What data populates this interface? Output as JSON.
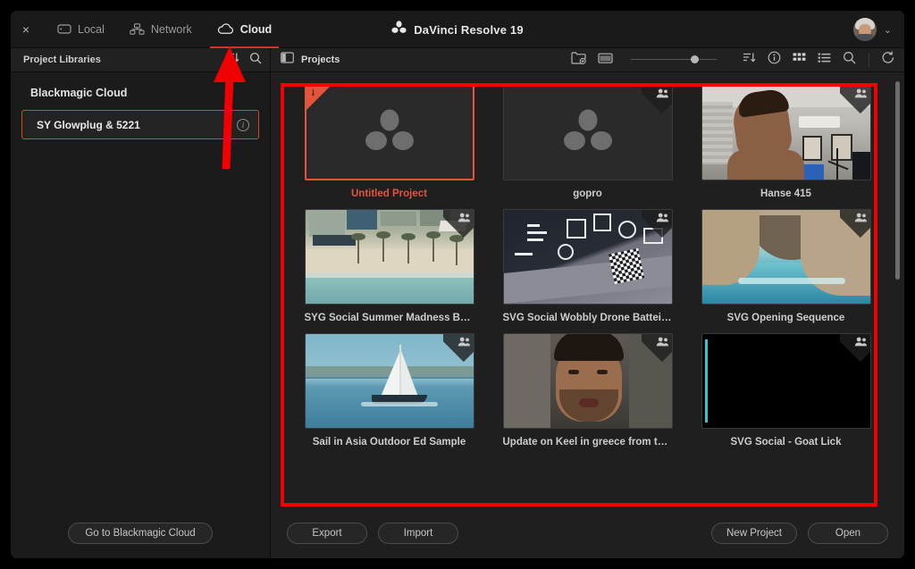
{
  "window": {
    "app_title": "DaVinci Resolve 19",
    "close_label": "×",
    "tabs": [
      {
        "label": "Local",
        "icon": "drive-icon",
        "active": false
      },
      {
        "label": "Network",
        "icon": "network-icon",
        "active": false
      },
      {
        "label": "Cloud",
        "icon": "cloud-icon",
        "active": true
      }
    ],
    "account_chevron": "⌄"
  },
  "sidebar": {
    "header": "Project Libraries",
    "header_icons": [
      "sort-icon",
      "search-icon"
    ],
    "group_title": "Blackmagic Cloud",
    "libraries": [
      {
        "name": "SY Glowplug & 5221",
        "selected": true,
        "info_glyph": "i"
      }
    ],
    "footer_button": "Go to Blackmagic Cloud"
  },
  "main": {
    "header": "Projects",
    "header_left_icon": "panel-toggle-icon",
    "toolbar_icons": [
      "new-folder-icon",
      "folder-icon",
      "thumbnail-size-slider",
      "sort-icon",
      "info-icon",
      "grid-view-icon",
      "list-view-icon",
      "search-icon"
    ],
    "refresh_icon": "refresh-icon",
    "zoom_slider_value": 70,
    "projects": [
      {
        "name": "Untitled Project",
        "selected": true,
        "collab": false,
        "thumb": "resolve-logo"
      },
      {
        "name": "gopro",
        "selected": false,
        "collab": true,
        "thumb": "resolve-logo"
      },
      {
        "name": "Hanse 415",
        "selected": false,
        "collab": true,
        "thumb": "hanse"
      },
      {
        "name": "SYG Social Summer Madness Beach",
        "selected": false,
        "collab": true,
        "thumb": "beach"
      },
      {
        "name": "SVG Social Wobbly Drone Batteies",
        "selected": false,
        "collab": true,
        "thumb": "battery"
      },
      {
        "name": "SVG Opening Sequence",
        "selected": false,
        "collab": true,
        "thumb": "cave"
      },
      {
        "name": "Sail in Asia Outdoor Ed Sample",
        "selected": false,
        "collab": true,
        "thumb": "sail"
      },
      {
        "name": "Update on Keel in greece from thai…",
        "selected": false,
        "collab": true,
        "thumb": "keel"
      },
      {
        "name": "SVG Social - Goat Lick",
        "selected": false,
        "collab": true,
        "thumb": "goat"
      }
    ],
    "footer": {
      "export": "Export",
      "import": "Import",
      "new_project": "New Project",
      "open": "Open"
    }
  },
  "annotations": {
    "highlight_rect_color": "#f00000",
    "arrow_color": "#f00000",
    "arrow_points_to": "sidebar-sort-icon"
  },
  "colors": {
    "accent": "#e2553a",
    "tab_underline": "#d93025",
    "window_bg": "#1f1f1f",
    "panel_bg": "#1b1b1b",
    "annotation_red": "#f00000"
  }
}
